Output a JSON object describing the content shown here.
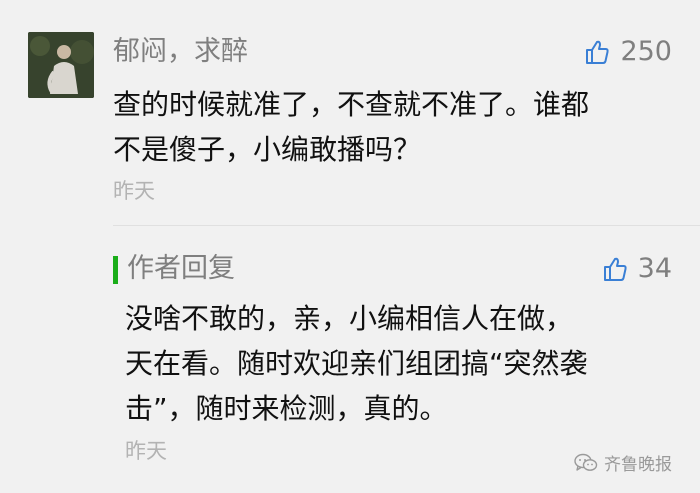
{
  "comment": {
    "username": "郁闷，求醉",
    "likes": "250",
    "like_icon": "thumbs-up-icon",
    "text_lines": [
      "查的时候就准了，不查就不准了。谁都",
      "不是傻子，小编敢播吗？"
    ],
    "time": "昨天"
  },
  "reply": {
    "label": "作者回复",
    "likes": "34",
    "like_icon": "thumbs-up-icon",
    "text_lines": [
      "没啥不敢的，亲，小编相信人在做，",
      "天在看。随时欢迎亲们组团搞“突然袭",
      "击”，随时来检测，真的。"
    ],
    "time": "昨天",
    "accent_color": "#1aad19"
  },
  "watermark": {
    "text": "齐鲁晚报",
    "icon": "wechat-icon"
  }
}
